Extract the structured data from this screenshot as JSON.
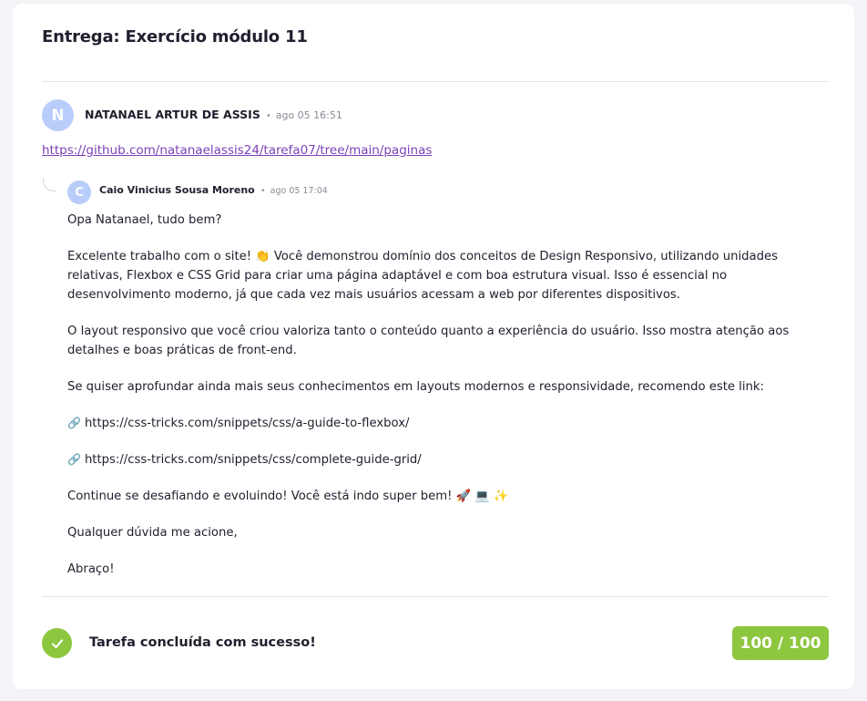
{
  "delivery": {
    "title": "Entrega: Exercício módulo 11"
  },
  "submission": {
    "avatar_initial": "N",
    "author": "NATANAEL ARTUR DE ASSIS",
    "separator": "•",
    "time": "ago 05 16:51",
    "link": "https://github.com/natanaelassis24/tarefa07/tree/main/paginas"
  },
  "reply": {
    "avatar_initial": "C",
    "author": "Caio Vinicius Sousa Moreno",
    "separator": "•",
    "time": "ago 05 17:04",
    "greeting": "Opa Natanael, tudo bem?",
    "paragraph_1": "Excelente trabalho com o site! 👏 Você demonstrou domínio dos conceitos de Design Responsivo, utilizando unidades relativas, Flexbox e CSS Grid para criar uma página adaptável e com boa estrutura visual. Isso é essencial no desenvolvimento moderno, já que cada vez mais usuários acessam a web por diferentes dispositivos.",
    "paragraph_2": "O layout responsivo que você criou valoriza tanto o conteúdo quanto a experiência do usuário. Isso mostra atenção aos detalhes e boas práticas de front-end.",
    "paragraph_3": "Se quiser aprofundar ainda mais seus conhecimentos em layouts modernos e responsividade, recomendo este link:",
    "link_icon": "🔗",
    "link_1": "https://css-tricks.com/snippets/css/a-guide-to-flexbox/",
    "link_2": "https://css-tricks.com/snippets/css/complete-guide-grid/",
    "encouragement": "Continue se desafiando e evoluindo! Você está indo super bem! 🚀 💻 ✨",
    "closing_1": "Qualquer dúvida me acione,",
    "closing_2": "Abraço!"
  },
  "result": {
    "status_text": "Tarefa concluída com sucesso!",
    "score": "100 / 100",
    "colors": {
      "success": "#8dc63f",
      "avatar": "#b9cdfb",
      "link": "#7b3fb8"
    }
  }
}
